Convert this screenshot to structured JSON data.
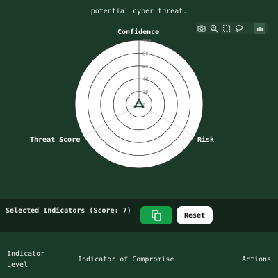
{
  "description": "potential cyber threat.",
  "toolbar": {
    "icons": [
      "camera-icon",
      "zoom-icon",
      "select-icon",
      "lasso-icon",
      "plotly-logo-icon"
    ]
  },
  "chart_data": {
    "type": "radar",
    "axes": [
      "Confidence",
      "Risk",
      "Threat Score"
    ],
    "radial_ticks": [
      "100",
      "80",
      "60",
      "40",
      "20",
      "0"
    ],
    "radial_range": [
      0,
      100
    ],
    "series": [
      {
        "values": [
          7,
          7,
          7
        ],
        "color": "#17492f"
      }
    ]
  },
  "selection": {
    "label": "Selected Indicators (Score: 7)",
    "reset_label": "Reset"
  },
  "table": {
    "col_level_line1": "Indicator",
    "col_level_line2": "Level",
    "col_ioc": "Indicator of Compromise",
    "col_actions": "Actions"
  }
}
